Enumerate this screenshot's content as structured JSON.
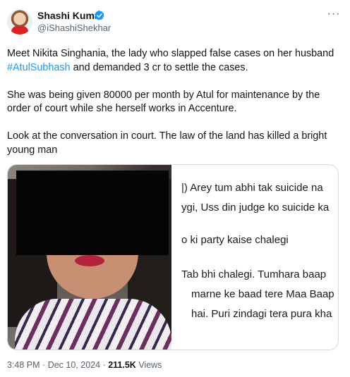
{
  "author": {
    "name": "Shashi Kumar",
    "handle": "@iShashiShekhar",
    "verified": true,
    "accent_color": "#1d9bf0"
  },
  "tweet": {
    "p1_before": "Meet Nikita Singhania, the lady who slapped false cases on her husband ",
    "hashtag": "#AtulSubhash",
    "p1_after": " and demanded 3 cr to settle the cases.",
    "p2": "She was being given 80000 per month by Atul for maintenance by the order of court while she herself works in Accenture.",
    "p3": "Look at the conversation in court. The law of the land has killed a bright young man"
  },
  "document_lines": [
    "|)  Arey tum abhi tak suicide na",
    "ygi, Uss din judge ko suicide ka",
    "o ki party kaise chalegi",
    "Tab bhi chalegi. Tumhara baap",
    "marne ke baad tere Maa Baap",
    "hai. Puri zindagi tera pura kha"
  ],
  "meta": {
    "time": "3:48 PM",
    "sep1": "·",
    "date": "Dec 10, 2024",
    "sep2": "·",
    "views_count": "211.5K",
    "views_label": "Views"
  },
  "icons": {
    "more": "more-icon",
    "verified": "verified-badge-icon"
  }
}
